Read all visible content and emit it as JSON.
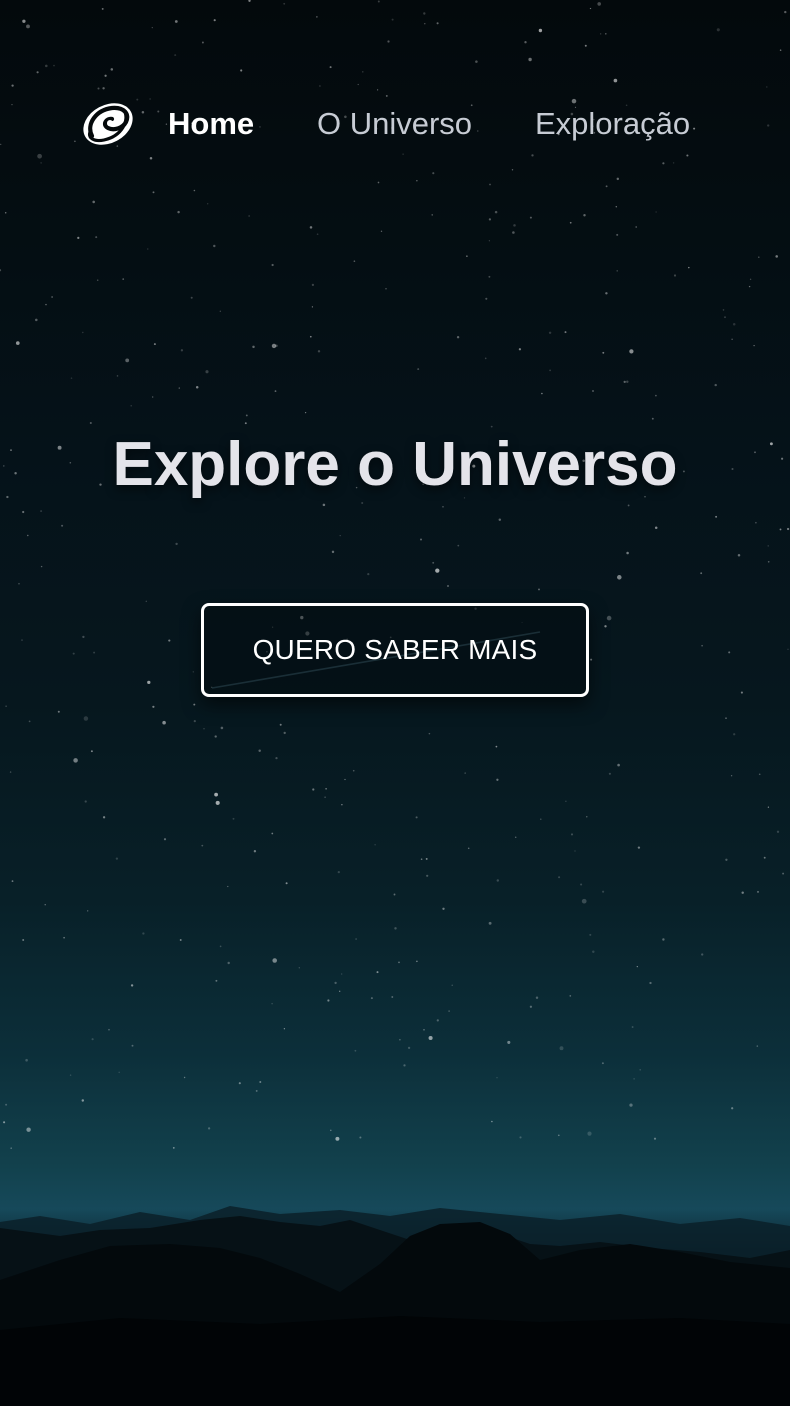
{
  "nav": {
    "logo_icon": "spiral-galaxy-icon",
    "items": [
      {
        "label": "Home",
        "active": true
      },
      {
        "label": "O Universo",
        "active": false
      },
      {
        "label": "Exploração",
        "active": false
      }
    ]
  },
  "hero": {
    "title": "Explore o Universo",
    "cta_label": "QUERO SABER MAIS"
  },
  "colors": {
    "sky_top": "#03090c",
    "sky_horizon": "#16495a",
    "text_active": "#ffffff",
    "text_inactive": "#c7ccd4",
    "title": "#e4e4ea"
  }
}
